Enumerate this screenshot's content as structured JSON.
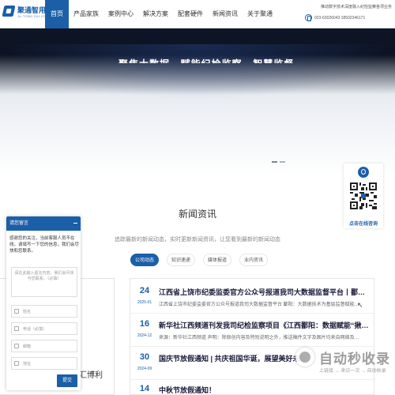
{
  "brand": {
    "name": "聚通智用",
    "sub": "JU TONG ZHI YONG"
  },
  "nav": {
    "items": [
      "首页",
      "产品家族",
      "案例中心",
      "解决方案",
      "配套硬件",
      "新闻资讯",
      "关于聚通"
    ],
    "active_index": 0
  },
  "header": {
    "slogan": "推动数字技术深度融入纪检监察各项业务",
    "phone": "023-63026043 18502346171"
  },
  "banner": {
    "headline": "聚焦大数据 · 赋能纪检监察 · 智慧监督"
  },
  "news_section": {
    "title": "新闻资讯",
    "subtitle": "追踪最新的新闻动态，实时更新新闻资讯，让您看到最新的新闻动态",
    "tabs": [
      "公司动态",
      "知识速递",
      "媒体报道",
      "业内资讯"
    ],
    "active_tab": 0,
    "left_caption": "汇博利",
    "items": [
      {
        "day": "24",
        "ym": "2025-01",
        "title": "江西省上饶市纪委监委官方公众号报道我司大数据监督平台丨鄱阳：大数据…",
        "summary": "江西省上饶市纪委监委官方公众号报道我司大数据监督平台 鄱阳：大数据技术为基层监督赋能…"
      },
      {
        "day": "16",
        "ym": "2024-12",
        "title": "新华社江西频道刊发我司纪检监察项目《江西鄱阳：数据赋能“揪”出群众…",
        "summary": "来源：新华社江西频道 声明：除原创内容及特别说明之外，推送稿件文字及图片均来自网络及…"
      },
      {
        "day": "30",
        "ym": "2024-09",
        "title": "国庆节放假通知 | 共庆祖国华诞，展望美好未来",
        "summary": ""
      },
      {
        "day": "14",
        "ym": "",
        "title": "中秋节放假通知！",
        "summary": ""
      }
    ]
  },
  "qr_float": {
    "label": "点击在线咨询"
  },
  "message_widget": {
    "title": "请您留言",
    "intro": "感谢您的关注，当前客服人员不在线，请填写一下您的信息，我们会尽快和您联系。",
    "textarea_placeholder": "请在此输入留言内容，我们会尽快与您联系。（必填）",
    "fields": [
      "姓名",
      "电话（必填）",
      "邮箱",
      "地址"
    ],
    "submit_label": "提交"
  },
  "watermark": {
    "name": "自动秒收录",
    "sub": "上链接 → 来访一次 → 自动收录"
  },
  "colors": {
    "brand": "#1b5fa8"
  }
}
